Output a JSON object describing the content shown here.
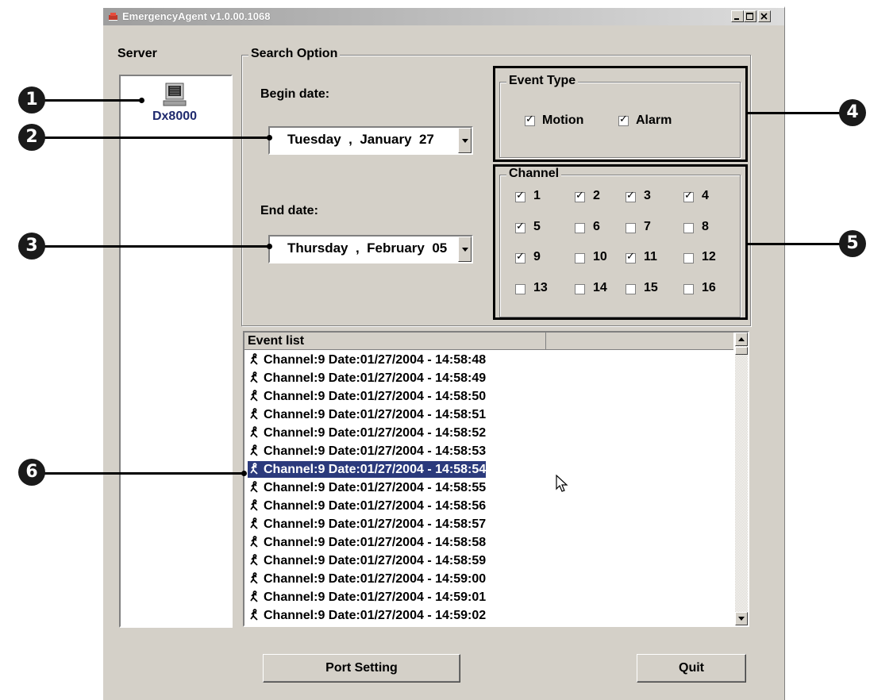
{
  "window": {
    "title": "EmergencyAgent v1.0.00.1068"
  },
  "server": {
    "label": "Server",
    "device_name": "Dx8000"
  },
  "search": {
    "group_label": "Search Option",
    "begin_label": "Begin date:",
    "begin_value": "Tuesday  ,  January  27",
    "end_label": "End date:",
    "end_value": "Thursday  ,  February  05"
  },
  "event_type": {
    "group_label": "Event Type",
    "options": [
      {
        "label": "Motion",
        "checked": true
      },
      {
        "label": "Alarm",
        "checked": true
      }
    ]
  },
  "channel": {
    "group_label": "Channel",
    "items": [
      {
        "label": "1",
        "checked": true
      },
      {
        "label": "2",
        "checked": true
      },
      {
        "label": "3",
        "checked": true
      },
      {
        "label": "4",
        "checked": true
      },
      {
        "label": "5",
        "checked": true
      },
      {
        "label": "6",
        "checked": false
      },
      {
        "label": "7",
        "checked": false
      },
      {
        "label": "8",
        "checked": false
      },
      {
        "label": "9",
        "checked": true
      },
      {
        "label": "10",
        "checked": false
      },
      {
        "label": "11",
        "checked": true
      },
      {
        "label": "12",
        "checked": false
      },
      {
        "label": "13",
        "checked": false
      },
      {
        "label": "14",
        "checked": false
      },
      {
        "label": "15",
        "checked": false
      },
      {
        "label": "16",
        "checked": false
      }
    ]
  },
  "event_list": {
    "header": "Event list",
    "selected_index": 6,
    "rows": [
      "Channel:9 Date:01/27/2004 - 14:58:48",
      "Channel:9 Date:01/27/2004 - 14:58:49",
      "Channel:9 Date:01/27/2004 - 14:58:50",
      "Channel:9 Date:01/27/2004 - 14:58:51",
      "Channel:9 Date:01/27/2004 - 14:58:52",
      "Channel:9 Date:01/27/2004 - 14:58:53",
      "Channel:9 Date:01/27/2004 - 14:58:54",
      "Channel:9 Date:01/27/2004 - 14:58:55",
      "Channel:9 Date:01/27/2004 - 14:58:56",
      "Channel:9 Date:01/27/2004 - 14:58:57",
      "Channel:9 Date:01/27/2004 - 14:58:58",
      "Channel:9 Date:01/27/2004 - 14:58:59",
      "Channel:9 Date:01/27/2004 - 14:59:00",
      "Channel:9 Date:01/27/2004 - 14:59:01",
      "Channel:9 Date:01/27/2004 - 14:59:02"
    ]
  },
  "buttons": {
    "port_setting": "Port Setting",
    "quit": "Quit"
  },
  "callouts": [
    "1",
    "2",
    "3",
    "4",
    "5",
    "6"
  ]
}
